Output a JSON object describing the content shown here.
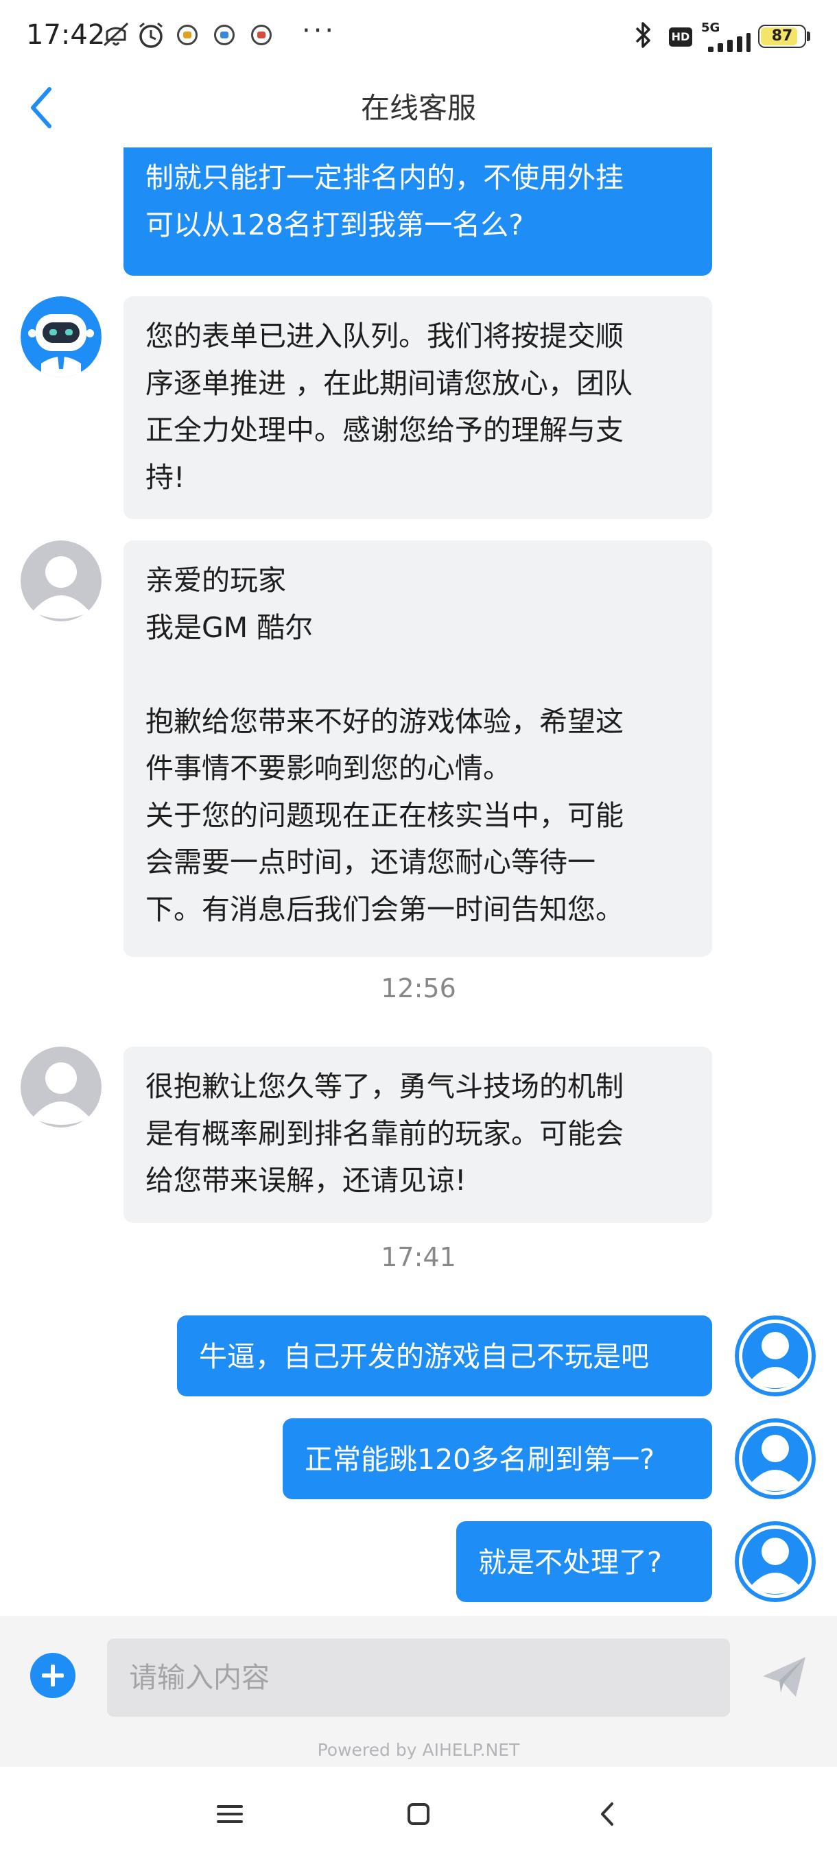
{
  "status_bar": {
    "time": "17:42",
    "more": "···",
    "hd_label": "HD",
    "network_label": "5G",
    "battery_level": "87",
    "icons": [
      "mute-icon",
      "alarm-icon",
      "app-notification-icon",
      "app-notification-icon",
      "app-notification-icon",
      "bluetooth-icon",
      "signal-icon",
      "battery-icon"
    ]
  },
  "header": {
    "title": "在线客服",
    "back_icon": "chevron-left-icon"
  },
  "messages": [
    {
      "side": "out",
      "text": "制就只能打一定排名内的，不使用外挂\n可以从128名打到我第一名么?"
    },
    {
      "side": "in",
      "avatar": "robot-avatar",
      "text": "您的表单已进入队列。我们将按提交顺\n序逐单推进 ，在此期间请您放心，团队\n正全力处理中。感谢您给予的理解与支\n持!"
    },
    {
      "side": "in",
      "avatar": "default-user-avatar",
      "text": "亲爱的玩家\n我是GM 酷尔\n\n抱歉给您带来不好的游戏体验，希望这\n件事情不要影响到您的心情。\n关于您的问题现在正在核实当中，可能\n会需要一点时间，还请您耐心等待一\n下。有消息后我们会第一时间告知您。"
    },
    {
      "type": "time",
      "text": "12:56"
    },
    {
      "side": "in",
      "avatar": "default-user-avatar",
      "text": "很抱歉让您久等了，勇气斗技场的机制\n是有概率刷到排名靠前的玩家。可能会\n给您带来误解，还请见谅!"
    },
    {
      "type": "time",
      "text": "17:41"
    },
    {
      "side": "out",
      "avatar": "self-avatar",
      "text": "牛逼，自己开发的游戏自己不玩是吧"
    },
    {
      "side": "out",
      "avatar": "self-avatar",
      "text": "正常能跳120多名刷到第一?"
    },
    {
      "side": "out",
      "avatar": "self-avatar",
      "text": "就是不处理了?"
    }
  ],
  "input": {
    "placeholder": "请输入内容",
    "value": "",
    "add_icon": "plus-circle-icon",
    "send_icon": "send-icon"
  },
  "footer": {
    "powered_by": "Powered by AIHELP.NET"
  },
  "nav": {
    "icons": [
      "menu-icon",
      "home-icon",
      "back-icon"
    ]
  },
  "colors": {
    "accent": "#1E8DF5",
    "incoming_bubble": "#F1F2F4",
    "input_bar": "#F4F4F5"
  }
}
